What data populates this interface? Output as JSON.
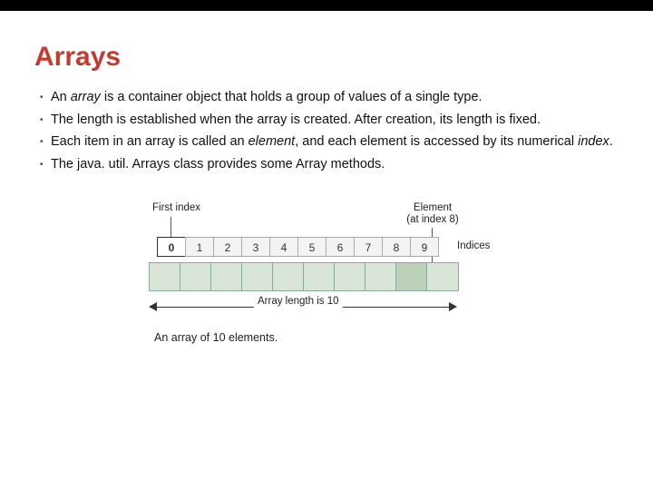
{
  "title": "Arrays",
  "bullets": [
    {
      "pre": "An ",
      "em1": "array",
      "mid": " is a container object that holds a group of values of a single type.",
      "em2": "",
      "post": ""
    },
    {
      "pre": "The length is established when the array is created. After creation, its length is fixed.",
      "em1": "",
      "mid": "",
      "em2": "",
      "post": ""
    },
    {
      "pre": "Each item in an array is called an ",
      "em1": "element",
      "mid": ", and each element is accessed by its numerical ",
      "em2": "index",
      "post": "."
    },
    {
      "pre": "The java. util. Arrays class provides some Array methods.",
      "em1": "",
      "mid": "",
      "em2": "",
      "post": ""
    }
  ],
  "fig": {
    "first_index_label": "First index",
    "element_label_l1": "Element",
    "element_label_l2": "(at index 8)",
    "indices_label": "Indices",
    "length_label": "Array length is 10",
    "caption": "An array of 10 elements.",
    "indices": [
      "0",
      "1",
      "2",
      "3",
      "4",
      "5",
      "6",
      "7",
      "8",
      "9"
    ]
  }
}
